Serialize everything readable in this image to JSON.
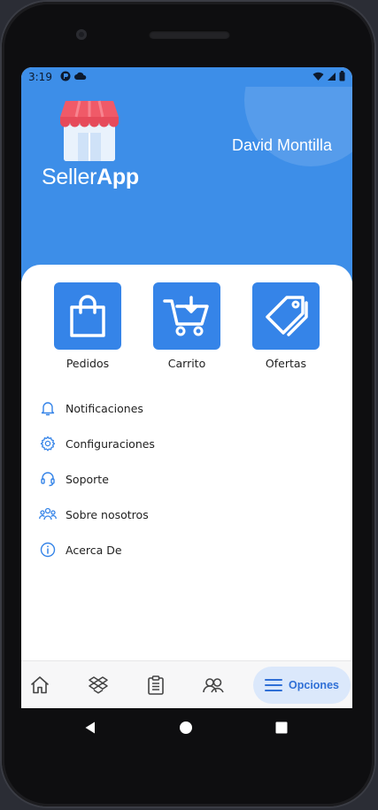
{
  "status_bar": {
    "time": "3:19"
  },
  "header": {
    "logo_text_regular": "Seller",
    "logo_text_bold": "App",
    "user_name": "David Montilla"
  },
  "actions": [
    {
      "label": "Pedidos",
      "icon": "shopping-bag-icon"
    },
    {
      "label": "Carrito",
      "icon": "cart-icon"
    },
    {
      "label": "Ofertas",
      "icon": "tags-icon"
    }
  ],
  "menu": [
    {
      "label": "Notificaciones",
      "icon": "bell-icon"
    },
    {
      "label": "Configuraciones",
      "icon": "gear-icon"
    },
    {
      "label": "Soporte",
      "icon": "headset-icon"
    },
    {
      "label": "Sobre nosotros",
      "icon": "group-icon"
    },
    {
      "label": "Acerca De",
      "icon": "info-icon"
    }
  ],
  "bottom_nav": {
    "items": [
      "home-icon",
      "dropbox-icon",
      "clipboard-icon",
      "users-icon"
    ],
    "active_label": "Opciones",
    "active_icon": "hamburger-icon"
  },
  "colors": {
    "primary": "#3d8ee8",
    "tile": "#3584e8",
    "icon_blue": "#3584e8",
    "active_pill": "#dbe8fb",
    "active_text": "#2f6fd6"
  }
}
